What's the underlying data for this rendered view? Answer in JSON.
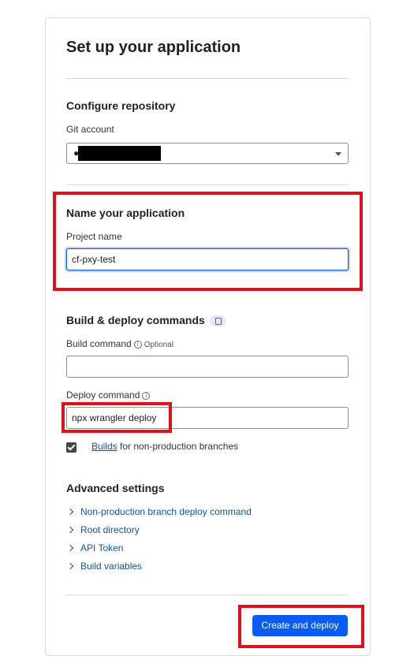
{
  "page": {
    "title": "Set up your application"
  },
  "configure_repository": {
    "title": "Configure repository",
    "git_account_label": "Git account"
  },
  "name_application": {
    "title": "Name your application",
    "project_name_label": "Project name",
    "project_name_value": "cf-pxy-test"
  },
  "build_deploy": {
    "title": "Build & deploy commands",
    "build_command_label": "Build command",
    "build_command_optional": "Optional",
    "build_command_value": "",
    "deploy_command_label": "Deploy command",
    "deploy_command_value": "npx wrangler deploy",
    "builds_checkbox_checked": true,
    "builds_link": "Builds",
    "builds_text": " for non-production branches"
  },
  "advanced_settings": {
    "title": "Advanced settings",
    "items": [
      {
        "label": "Non-production branch deploy command"
      },
      {
        "label": "Root directory"
      },
      {
        "label": "API Token"
      },
      {
        "label": "Build variables"
      }
    ]
  },
  "actions": {
    "create_deploy_label": "Create and deploy"
  },
  "colors": {
    "primary": "#0a5cf5",
    "link": "#0b55a8",
    "annotation": "#e0111c"
  }
}
